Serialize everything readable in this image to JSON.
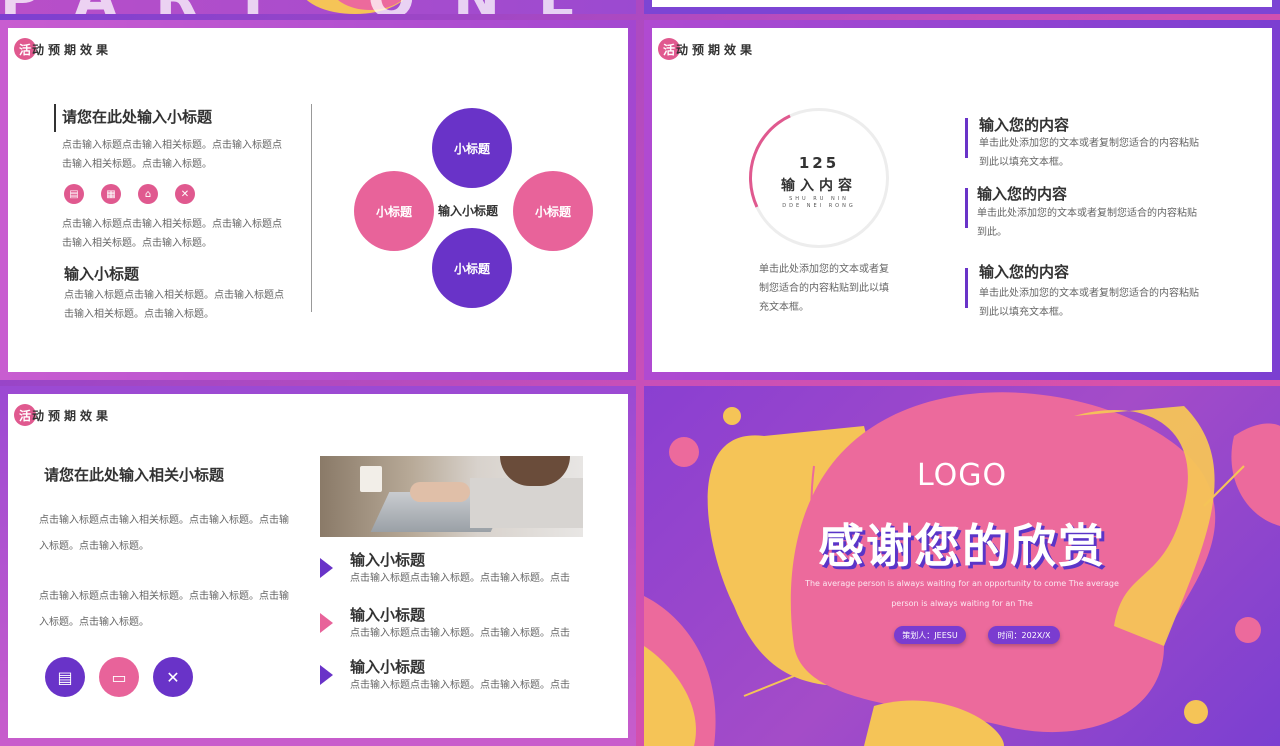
{
  "top_strip": {
    "bigtext": "PART ONE"
  },
  "section_head": {
    "first_char": "活",
    "rest": "动预期效果"
  },
  "slide_a": {
    "title": "请您在此处输入小标题",
    "para1": "点击输入标题点击输入相关标题。点击输入标题点击输入相关标题。点击输入标题。",
    "para2": "点击输入标题点击输入相关标题。点击输入标题点击输入相关标题。点击输入标题。",
    "subtitle": "输入小标题",
    "para3": "点击输入标题点击输入相关标题。点击输入标题点击输入相关标题。点击输入标题。",
    "icons": [
      "document-icon",
      "calendar-icon",
      "home-icon",
      "tools-icon"
    ],
    "petals": {
      "top": "小标题",
      "left": "小标题",
      "right": "小标题",
      "bottom": "小标题"
    },
    "center": "输入小标题"
  },
  "slide_b": {
    "ring_number": "125",
    "ring_title": "输入内容",
    "ring_sub": "SHU RU NIN DDE NEI RONG",
    "left_text": "单击此处添加您的文本或者复制您适合的内容粘贴到此以填充文本框。",
    "items": [
      {
        "title": "输入您的内容",
        "text": "单击此处添加您的文本或者复制您适合的内容粘贴到此以填充文本框。"
      },
      {
        "title": "输入您的内容",
        "text": "单击此处添加您的文本或者复制您适合的内容粘贴到此。"
      },
      {
        "title": "输入您的内容",
        "text": "单击此处添加您的文本或者复制您适合的内容粘贴到此以填充文本框。"
      }
    ]
  },
  "slide_c": {
    "title": "请您在此处输入相关小标题",
    "para1": "点击输入标题点击输入相关标题。点击输入标题。点击输入标题。点击输入标题。",
    "para2": "点击输入标题点击输入相关标题。点击输入标题。点击输入标题。点击输入标题。",
    "items": [
      {
        "title": "输入小标题",
        "text": "点击输入标题点击输入标题。点击输入标题。点击"
      },
      {
        "title": "输入小标题",
        "text": "点击输入标题点击输入标题。点击输入标题。点击"
      },
      {
        "title": "输入小标题",
        "text": "点击输入标题点击输入标题。点击输入标题。点击"
      }
    ],
    "icons": [
      "document-icon",
      "wallet-icon",
      "tools-icon"
    ]
  },
  "slide_d": {
    "logo": "LOGO",
    "title": "感谢您的欣赏",
    "subtitle": "The average person is always waiting for an opportunity to come The average person is always waiting for an The",
    "planner": "策划人：JEESU",
    "time": "时间：202X/X"
  },
  "colors": {
    "purple": "#6933c8",
    "pink": "#e8639a",
    "yellow": "#f5c457"
  }
}
